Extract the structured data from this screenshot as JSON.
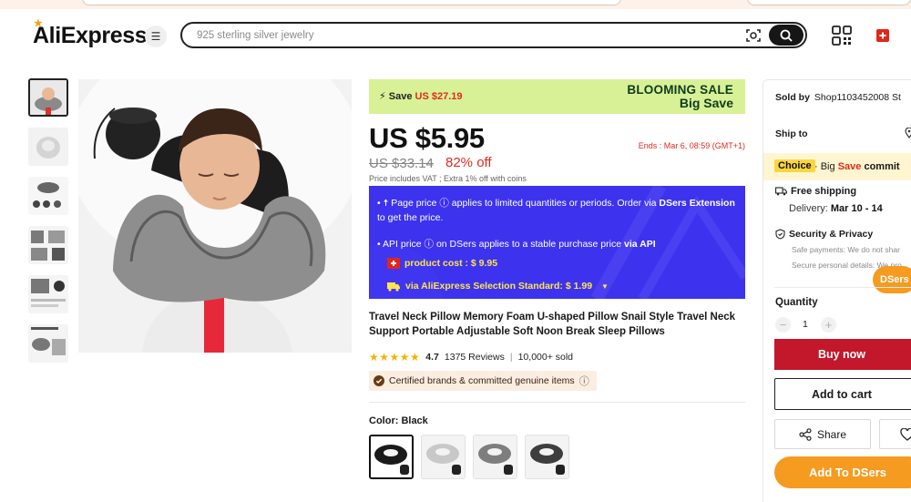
{
  "header": {
    "logo": "AliExpress",
    "search_placeholder": "925 sterling silver jewelry"
  },
  "icons": {
    "menu": "hamburger-icon",
    "scan": "camera-scan-icon",
    "search": "search-icon",
    "qr": "qr-code-icon",
    "region": "swiss-flag-icon"
  },
  "gallery": {
    "thumbnail_count": 6,
    "main_image": "travel-neck-pillow-photo"
  },
  "sale_banner": {
    "save_label": "Save",
    "save_amount": "US $27.19",
    "title": "BLOOMING SALE",
    "subtitle": "Big Save"
  },
  "pricing": {
    "price": "US $5.95",
    "ends": "Ends :  Mar 6, 08:59 (GMT+1)",
    "original_price": "US $33.14",
    "discount": "82% off",
    "vat_note": "Price includes VAT ; Extra 1% off with coins"
  },
  "dsers_box": {
    "line1_pre": "• ",
    "line1_a": " Page price ",
    "line1_b": " applies to limited quantities or periods. Order via ",
    "line1_brand": "DSers Extension",
    "line1_c": " to get the price.",
    "line2_a": "• API price ",
    "line2_b": " on DSers applies to a stable purchase price ",
    "line2_c": "via API",
    "product_cost": "product cost : $ 9.95",
    "standard": "via AliExpress Selection Standard:  $  1.99"
  },
  "product": {
    "title": "Travel Neck Pillow Memory Foam U-shaped Pillow Snail Style Travel Neck Support Portable Adjustable Soft Noon Break Sleep Pillows",
    "rating": "4.7",
    "reviews": "1375 Reviews",
    "sold": "10,000+ sold",
    "certified": "Certified brands & committed genuine items",
    "color_label": "Color: Black",
    "swatch_colors": [
      "black",
      "light-gray",
      "gray",
      "dark-gray"
    ]
  },
  "side_panel": {
    "sold_by_label": "Sold by",
    "sold_by_value": "Shop1103452008 St",
    "ship_to": "Ship to",
    "choice_badge": "Choice",
    "choice_dot": " · Big ",
    "choice_save": "Save",
    "choice_rest": "  commit",
    "free_shipping": "Free shipping",
    "delivery_label": "Delivery: ",
    "delivery_dates": "Mar 10 - 14",
    "security": "Security & Privacy",
    "safe_payments": "Safe payments: We do not shar",
    "secure_personal": "Secure personal details: We pro",
    "dsers_float": "DSers",
    "quantity_label": "Quantity",
    "quantity_value": "1",
    "buy_now": "Buy now",
    "add_to_cart": "Add to cart",
    "share": "Share",
    "add_to_dsers": "Add To DSers"
  },
  "colors": {
    "sale_bg": "#d9f196",
    "accent_red": "#e12b1e",
    "dsers_blue": "#3d33ee",
    "dsers_orange": "#f59b20",
    "buy_red": "#c3172b",
    "star": "#f3b300"
  }
}
